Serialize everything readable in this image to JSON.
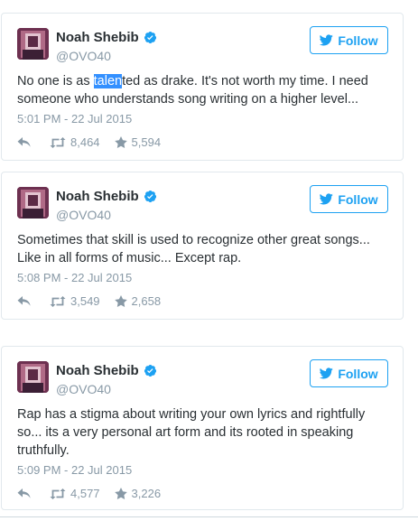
{
  "tweets": [
    {
      "name": "Noah Shebib",
      "handle": "@OVO40",
      "follow_label": "Follow",
      "text_before": "No one is as ",
      "text_highlight": "talen",
      "text_after": "ted as drake. It's not worth my time. I need someone who understands song writing on a higher level...",
      "timestamp": "5:01 PM - 22 Jul 2015",
      "retweets": "8,464",
      "likes": "5,594"
    },
    {
      "name": "Noah Shebib",
      "handle": "@OVO40",
      "follow_label": "Follow",
      "text": "Sometimes that skill is used to recognize other great songs... Like in all forms of music... Except rap.",
      "timestamp": "5:08 PM - 22 Jul 2015",
      "retweets": "3,549",
      "likes": "2,658"
    },
    {
      "name": "Noah Shebib",
      "handle": "@OVO40",
      "follow_label": "Follow",
      "text": "Rap has a stigma about writing your own lyrics and rightfully so... its a very personal art form and its rooted in speaking truthfully.",
      "timestamp": "5:09 PM - 22 Jul 2015",
      "retweets": "4,577",
      "likes": "3,226"
    }
  ],
  "icons": {
    "verified": "verified-badge-icon",
    "follow": "bird-icon",
    "reply": "reply-icon",
    "retweet": "retweet-icon",
    "like": "star-icon"
  },
  "colors": {
    "accent": "#1da1f2",
    "muted": "#8899a6",
    "text": "#292f33",
    "selection": "#3390ff"
  }
}
